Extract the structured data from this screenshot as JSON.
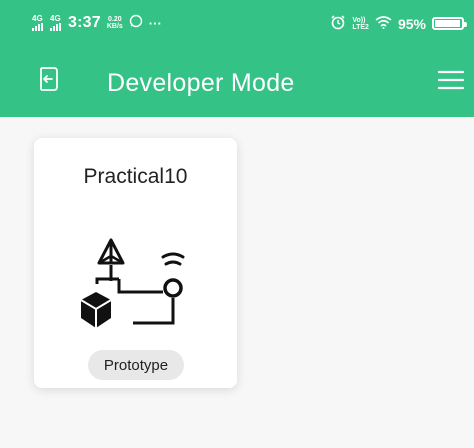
{
  "status_bar": {
    "net1": "4G",
    "net2": "4G",
    "time": "3:37",
    "speed_value": "0.20",
    "speed_unit": "KB/s",
    "more": "···",
    "volte_line1": "Vo))",
    "volte_line2": "LTE2",
    "battery": "95%",
    "battery_level": 0.95
  },
  "app_bar": {
    "title": "Developer Mode",
    "color": "#35c286"
  },
  "cards": [
    {
      "title": "Practical10",
      "tag": "Prototype"
    }
  ]
}
